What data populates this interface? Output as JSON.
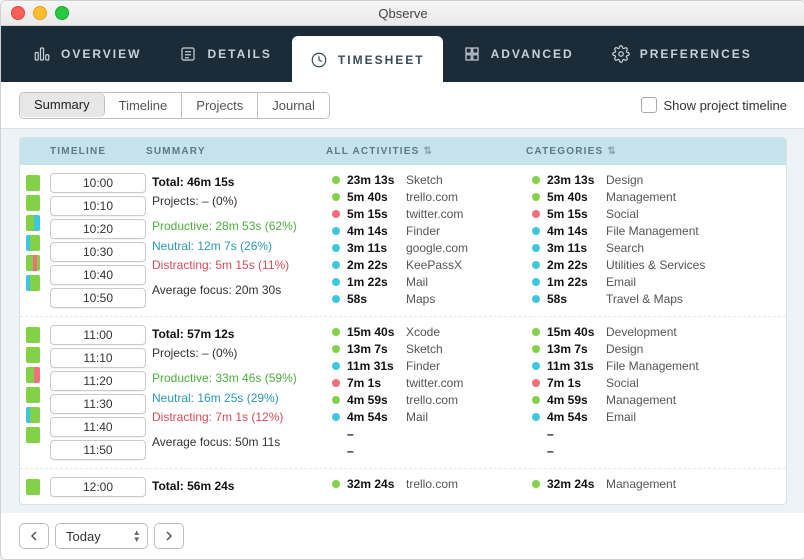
{
  "window_title": "Qbserve",
  "nav": {
    "overview": "OVERVIEW",
    "details": "DETAILS",
    "timesheet": "TIMESHEET",
    "advanced": "ADVANCED",
    "preferences": "PREFERENCES"
  },
  "segments": {
    "summary": "Summary",
    "timeline": "Timeline",
    "projects": "Projects",
    "journal": "Journal"
  },
  "show_project_timeline": "Show project timeline",
  "headers": {
    "timeline": "TIMELINE",
    "summary": "SUMMARY",
    "activities": "ALL ACTIVITIES",
    "categories": "CATEGORIES"
  },
  "date_selector": "Today",
  "colors": {
    "green": "#83d147",
    "red": "#f16e7a",
    "blue": "#3cc7de"
  },
  "hours": [
    {
      "bars": [
        [
          [
            "green",
            100
          ]
        ],
        [
          [
            "green",
            100
          ]
        ],
        [
          [
            "green",
            60
          ],
          [
            "blue",
            40
          ]
        ],
        [
          [
            "blue",
            30
          ],
          [
            "green",
            70
          ]
        ],
        [
          [
            "green",
            50
          ],
          [
            "red",
            30
          ],
          [
            "green",
            20
          ]
        ],
        [
          [
            "blue",
            25
          ],
          [
            "green",
            75
          ]
        ]
      ],
      "chips": [
        "10:00",
        "10:10",
        "10:20",
        "10:30",
        "10:40",
        "10:50"
      ],
      "summary": {
        "total_label": "Total:",
        "total": "46m 15s",
        "projects": "Projects: – (0%)",
        "productive": "Productive: 28m 53s (62%)",
        "neutral": "Neutral: 12m 7s (26%)",
        "distracting": "Distracting: 5m 15s (11%)",
        "focus": "Average focus: 20m 30s"
      },
      "activities": [
        {
          "c": "green",
          "dur": "23m 13s",
          "name": "Sketch"
        },
        {
          "c": "green",
          "dur": "5m 40s",
          "name": "trello.com"
        },
        {
          "c": "red",
          "dur": "5m 15s",
          "name": "twitter.com"
        },
        {
          "c": "blue",
          "dur": "4m 14s",
          "name": "Finder"
        },
        {
          "c": "blue",
          "dur": "3m 11s",
          "name": "google.com"
        },
        {
          "c": "blue",
          "dur": "2m 22s",
          "name": "KeePassX"
        },
        {
          "c": "blue",
          "dur": "1m 22s",
          "name": "Mail"
        },
        {
          "c": "blue",
          "dur": "58s",
          "name": "Maps"
        }
      ],
      "categories": [
        {
          "c": "green",
          "dur": "23m 13s",
          "name": "Design"
        },
        {
          "c": "green",
          "dur": "5m 40s",
          "name": "Management"
        },
        {
          "c": "red",
          "dur": "5m 15s",
          "name": "Social"
        },
        {
          "c": "blue",
          "dur": "4m 14s",
          "name": "File Management"
        },
        {
          "c": "blue",
          "dur": "3m 11s",
          "name": "Search"
        },
        {
          "c": "blue",
          "dur": "2m 22s",
          "name": "Utilities & Services"
        },
        {
          "c": "blue",
          "dur": "1m 22s",
          "name": "Email"
        },
        {
          "c": "blue",
          "dur": "58s",
          "name": "Travel & Maps"
        }
      ]
    },
    {
      "bars": [
        [
          [
            "green",
            100
          ]
        ],
        [
          [
            "green",
            100
          ]
        ],
        [
          [
            "green",
            60
          ],
          [
            "red",
            40
          ]
        ],
        [
          [
            "green",
            100
          ]
        ],
        [
          [
            "blue",
            30
          ],
          [
            "green",
            70
          ]
        ],
        [
          [
            "green",
            100
          ]
        ]
      ],
      "chips": [
        "11:00",
        "11:10",
        "11:20",
        "11:30",
        "11:40",
        "11:50"
      ],
      "summary": {
        "total_label": "Total:",
        "total": "57m 12s",
        "projects": "Projects: – (0%)",
        "productive": "Productive: 33m 46s (59%)",
        "neutral": "Neutral: 16m 25s (29%)",
        "distracting": "Distracting: 7m 1s (12%)",
        "focus": "Average focus: 50m 11s"
      },
      "activities": [
        {
          "c": "green",
          "dur": "15m 40s",
          "name": "Xcode"
        },
        {
          "c": "green",
          "dur": "13m 7s",
          "name": "Sketch"
        },
        {
          "c": "blue",
          "dur": "11m 31s",
          "name": "Finder"
        },
        {
          "c": "red",
          "dur": "7m 1s",
          "name": "twitter.com"
        },
        {
          "c": "green",
          "dur": "4m 59s",
          "name": "trello.com"
        },
        {
          "c": "blue",
          "dur": "4m 54s",
          "name": "Mail"
        },
        {
          "c": "",
          "dur": "–",
          "name": ""
        },
        {
          "c": "",
          "dur": "–",
          "name": ""
        }
      ],
      "categories": [
        {
          "c": "green",
          "dur": "15m 40s",
          "name": "Development"
        },
        {
          "c": "green",
          "dur": "13m 7s",
          "name": "Design"
        },
        {
          "c": "blue",
          "dur": "11m 31s",
          "name": "File Management"
        },
        {
          "c": "red",
          "dur": "7m 1s",
          "name": "Social"
        },
        {
          "c": "green",
          "dur": "4m 59s",
          "name": "Management"
        },
        {
          "c": "blue",
          "dur": "4m 54s",
          "name": "Email"
        },
        {
          "c": "",
          "dur": "–",
          "name": ""
        },
        {
          "c": "",
          "dur": "–",
          "name": ""
        }
      ]
    },
    {
      "bars": [
        [
          [
            "green",
            100
          ]
        ]
      ],
      "chips": [
        "12:00"
      ],
      "summary": {
        "total_label": "Total:",
        "total": "56m 24s",
        "projects": "",
        "productive": "",
        "neutral": "",
        "distracting": "",
        "focus": ""
      },
      "activities": [
        {
          "c": "green",
          "dur": "32m 24s",
          "name": "trello.com"
        }
      ],
      "categories": [
        {
          "c": "green",
          "dur": "32m 24s",
          "name": "Management"
        }
      ]
    }
  ]
}
